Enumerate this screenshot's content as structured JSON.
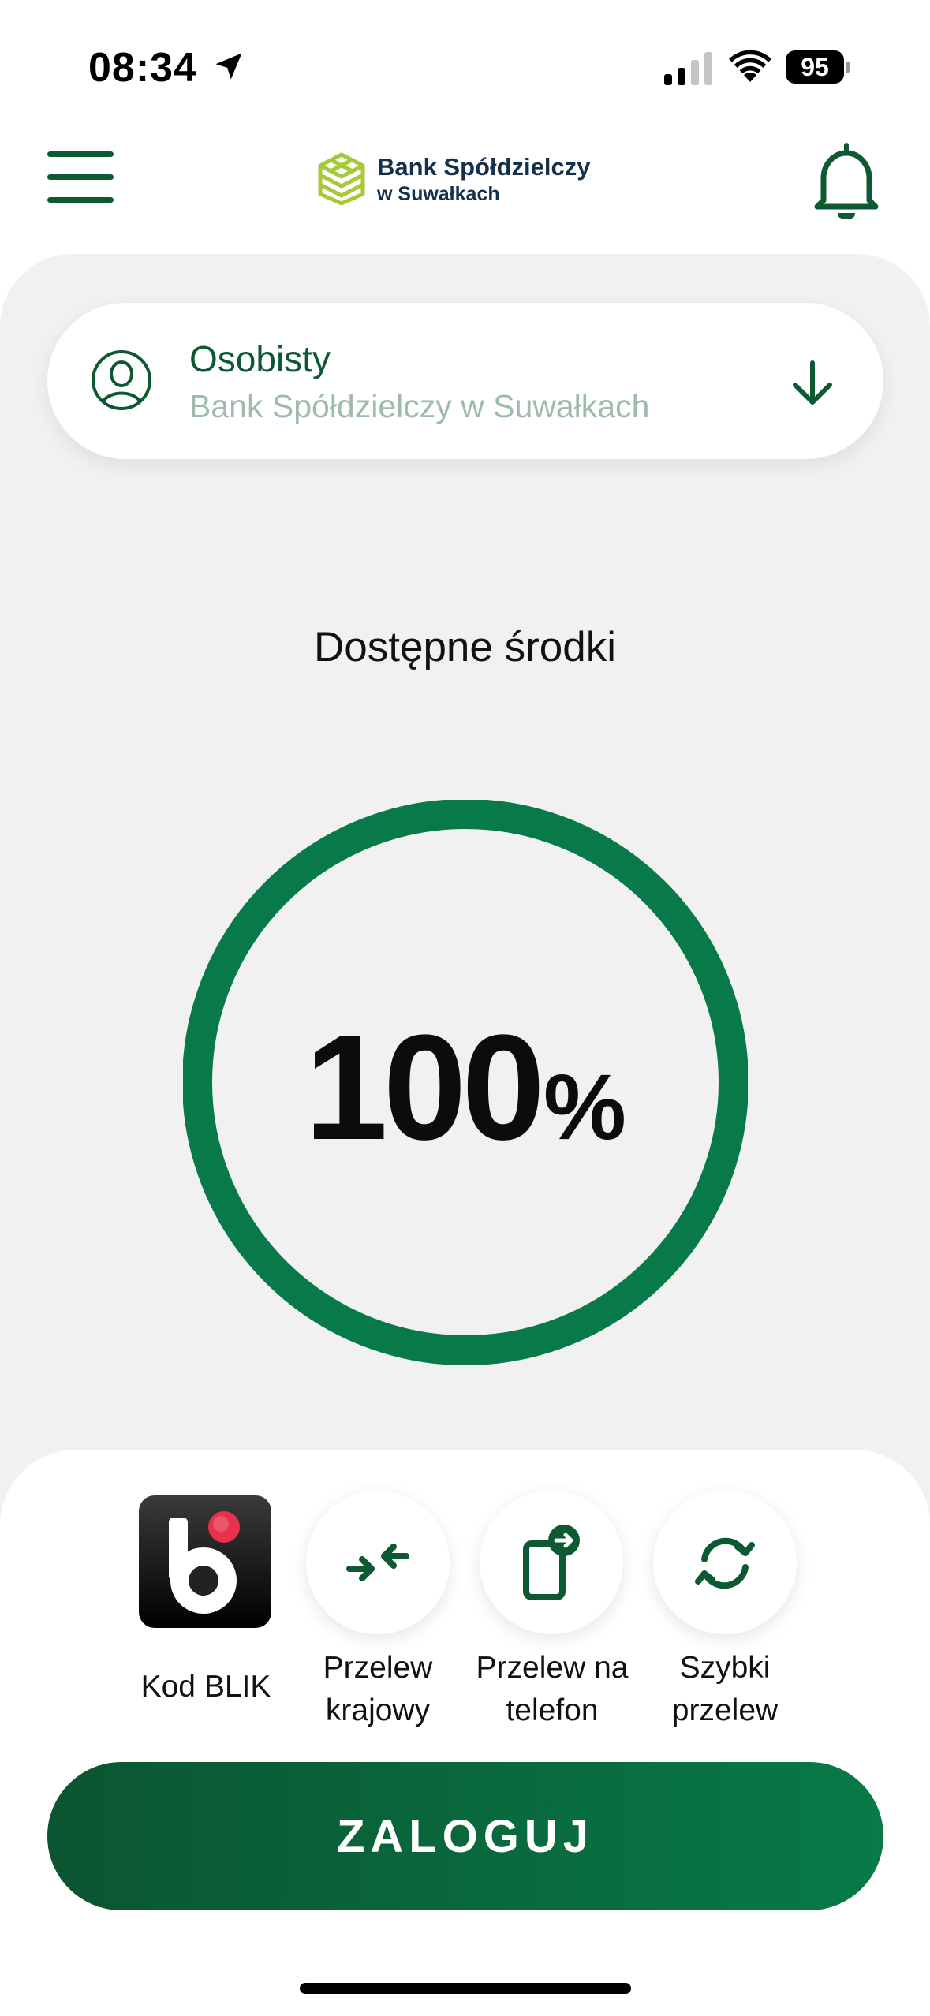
{
  "status_bar": {
    "time": "08:34",
    "battery": "95",
    "location_icon": "location-arrow-icon",
    "signal_icon": "cellular-signal-icon",
    "wifi_icon": "wifi-icon"
  },
  "header": {
    "menu_icon": "hamburger-menu-icon",
    "logo_name": "Bank Spółdzielczy",
    "logo_sub": "w Suwałkach",
    "bell_icon": "bell-icon"
  },
  "account": {
    "name": "Osobisty",
    "bank": "Bank Spółdzielczy w Suwałkach",
    "avatar_icon": "user-icon",
    "arrow_icon": "arrow-down-icon"
  },
  "balance": {
    "label": "Dostępne środki",
    "percent_value": "100",
    "percent_sign": "%",
    "fill_fraction": 1.0
  },
  "actions": [
    {
      "label": "Kod BLIK",
      "icon": "blik-icon"
    },
    {
      "label": "Przelew\nkrajowy",
      "icon": "arrows-inward-icon"
    },
    {
      "label": "Przelew na\ntelefon",
      "icon": "phone-transfer-icon"
    },
    {
      "label": "Szybki\nprzelew",
      "icon": "refresh-icon"
    }
  ],
  "login": {
    "label": "ZALOGUJ"
  },
  "colors": {
    "brand_green": "#0d5a32",
    "gauge_green": "#087a4a",
    "muted_green": "#9ebca9",
    "logo_lime": "#a6c93a"
  }
}
